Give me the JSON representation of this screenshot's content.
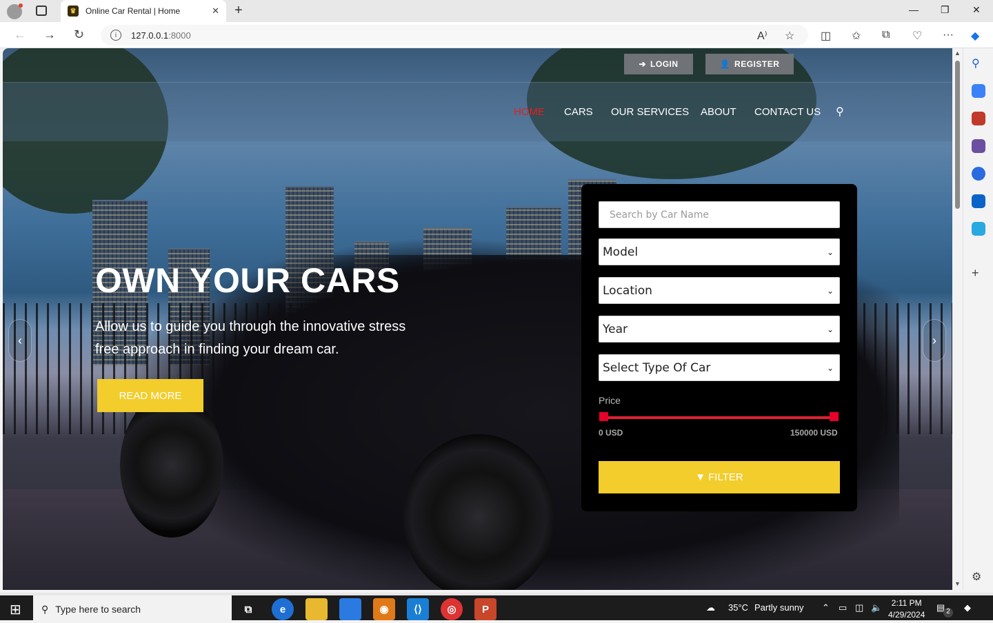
{
  "browser": {
    "tab_title": "Online Car Rental | Home",
    "tab_close": "✕",
    "new_tab": "+",
    "url_host": "127.0.0.1",
    "url_port": ":8000",
    "controls": {
      "minimize": "—",
      "restore": "❐",
      "close": "✕"
    },
    "toolbar_icons": [
      "read-aloud-icon",
      "favorite-icon",
      "split-screen-icon",
      "favorites-icon",
      "collections-icon",
      "browser-essentials-icon",
      "more-icon",
      "copilot-icon"
    ]
  },
  "sidebar": {
    "items": [
      "search-icon",
      "shopping-icon",
      "tools-icon",
      "games-icon",
      "office-icon",
      "outlook-icon",
      "telegram-icon",
      "add-icon",
      "settings-icon"
    ]
  },
  "site": {
    "login_label": "LOGIN",
    "register_label": "REGISTER",
    "nav": [
      {
        "label": "HOME",
        "active": true
      },
      {
        "label": "CARS",
        "active": false
      },
      {
        "label": "OUR SERVICES",
        "active": false
      },
      {
        "label": "ABOUT",
        "active": false
      },
      {
        "label": "CONTACT US",
        "active": false
      }
    ],
    "hero": {
      "title": "OWN YOUR CARS",
      "subtitle": "Allow us to guide you through the innovative stress free approach in finding your dream car.",
      "read_more": "READ MORE"
    },
    "filter": {
      "search_placeholder": "Search by Car Name",
      "model": "Model",
      "location": "Location",
      "year": "Year",
      "type": "Select Type Of Car",
      "price_label": "Price",
      "price_min": "0 USD",
      "price_max": "150000 USD",
      "filter_label": "FILTER"
    },
    "colors": {
      "accent": "#f2cd2c",
      "active_nav": "#e02020",
      "slider": "#e02030"
    }
  },
  "taskbar": {
    "search_placeholder": "Type here to search",
    "weather_temp": "35°C",
    "weather_text": "Partly sunny",
    "time": "2:11 PM",
    "date": "4/29/2024",
    "notification_count": "2"
  }
}
